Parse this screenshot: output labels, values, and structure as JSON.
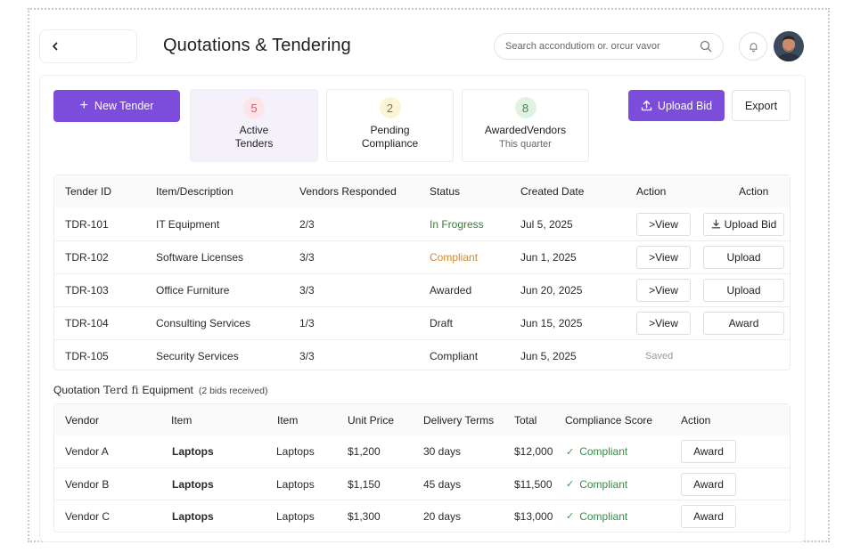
{
  "header": {
    "title": "Quotations & Tendering",
    "search_placeholder": "Search accondutiom or. orcur vavor"
  },
  "toolbar": {
    "new_tender_label": "New Tender",
    "upload_bid_label": "Upload Bid",
    "export_label": "Export"
  },
  "stats": [
    {
      "count": "5",
      "label_line1": "Active",
      "label_line2": "Tenders",
      "sub": "",
      "color": "#e8556b",
      "bg": "#fde4e7"
    },
    {
      "count": "2",
      "label_line1": "Pending",
      "label_line2": "Compliance",
      "sub": "",
      "color": "#8a7a1a",
      "bg": "#fbf5d6"
    },
    {
      "count": "8",
      "label_line1": "AwardedVendors",
      "label_line2": "",
      "sub": "This quarter",
      "color": "#3a8a4a",
      "bg": "#e0f3e2"
    }
  ],
  "tenders": {
    "headers": [
      "Tender ID",
      "Item/Description",
      "Vendors Responded",
      "Status",
      "Created Date",
      "Action",
      "Action"
    ],
    "rows": [
      {
        "id": "TDR-101",
        "item": "IT Equipment",
        "vendors": "2/3",
        "status": "In Frogress",
        "status_color": "#3a7a3a",
        "date": "Jul 5, 2025",
        "view": ">View",
        "action": "Upload Bid"
      },
      {
        "id": "TDR-102",
        "item": "Software Licenses",
        "vendors": "3/3",
        "status": "Compliant",
        "status_color": "#d08a2a",
        "date": "Jun 1, 2025",
        "view": ">View",
        "action": "Upload"
      },
      {
        "id": "TDR-103",
        "item": "Office Furniture",
        "vendors": "3/3",
        "status": "Awarded",
        "status_color": "#2a2a2a",
        "date": "Jun 20, 2025",
        "view": ">View",
        "action": "Upload"
      },
      {
        "id": "TDR-104",
        "item": "Consulting Services",
        "vendors": "1/3",
        "status": "Draft",
        "status_color": "#2a2a2a",
        "date": "Jun 15, 2025",
        "view": ">View",
        "action": "Award"
      },
      {
        "id": "TDR-105",
        "item": "Security Services",
        "vendors": "3/3",
        "status": "Compliant",
        "status_color": "#2a2a2a",
        "date": "Jun 5, 2025",
        "saved": "Saved"
      }
    ]
  },
  "quotation": {
    "title_prefix": "Quotation",
    "title_serif": "Terd fi",
    "title_suffix": "Equipment",
    "bids_note": "(2 bids received)",
    "headers": [
      "Vendor",
      "Item",
      "Item",
      "Unit Price",
      "Delivery Terms",
      "Total",
      "Compliance Score",
      "Action"
    ],
    "rows": [
      {
        "vendor": "Vendor A",
        "item_bold": "Laptops",
        "item": "Laptops",
        "unit_price": "$1,200",
        "delivery": "30 days",
        "total": "$12,000",
        "compliance": "Compliant",
        "action": "Award"
      },
      {
        "vendor": "Vendor B",
        "item_bold": "Laptops",
        "item": "Laptops",
        "unit_price": "$1,150",
        "delivery": "45 days",
        "total": "$11,500",
        "compliance": "Compliant",
        "action": "Award"
      },
      {
        "vendor": "Vendor C",
        "item_bold": "Laptops",
        "item": "Laptops",
        "unit_price": "$1,300",
        "delivery": "20 days",
        "total": "$13,000",
        "compliance": "Compliant",
        "action": "Award"
      }
    ]
  }
}
